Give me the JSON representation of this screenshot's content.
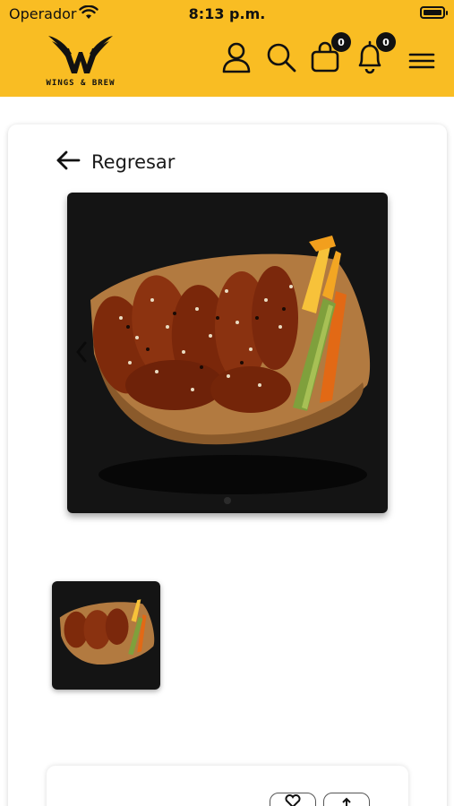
{
  "status_bar": {
    "carrier": "Operador",
    "time": "8:13 p.m."
  },
  "header": {
    "brand": "WINGS & BREW",
    "cart_count": "0",
    "notification_count": "0",
    "accent_color": "#f9bd23"
  },
  "page": {
    "back_label": "Regresar"
  },
  "icons": [
    "user-icon",
    "search-icon",
    "cart-icon",
    "bell-icon",
    "menu-icon",
    "back-arrow-icon",
    "chevron-left-icon",
    "heart-icon",
    "share-icon"
  ]
}
